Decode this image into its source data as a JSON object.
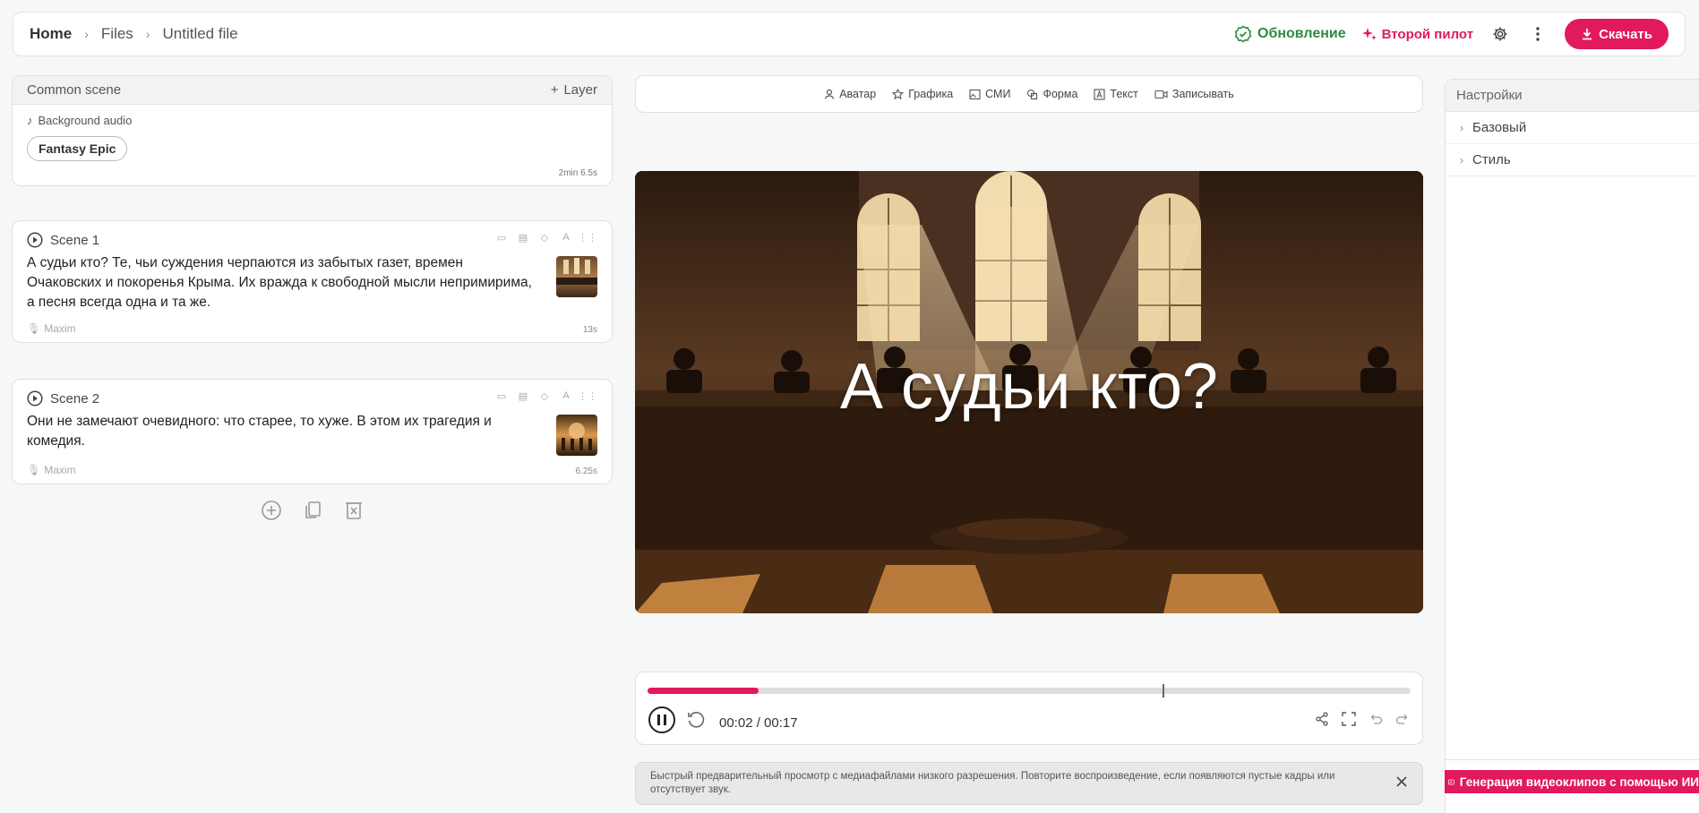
{
  "breadcrumb": {
    "home": "Home",
    "files": "Files",
    "file": "Untitled file"
  },
  "header": {
    "update_label": "Обновление",
    "copilot_label": "Второй пилот",
    "download_label": "Скачать"
  },
  "common_scene": {
    "title": "Common scene",
    "layer_label": "Layer",
    "bg_audio_label": "Background audio",
    "audio_chip": "Fantasy Epic",
    "duration": "2min 6.5s"
  },
  "scenes": [
    {
      "title": "Scene 1",
      "text": "А судьи кто? Те, чьи суждения черпаются из забытых газет, времен Очаковских и покоренья Крыма. Их вражда к свободной мысли непримирима, а песня всегда одна и та же.",
      "voice": "Maxim",
      "duration": "13s"
    },
    {
      "title": "Scene 2",
      "text": "Они не замечают очевидного: что старее, то хуже. В этом их трагедия и комедия.",
      "voice": "Maxim",
      "duration": "6.25s"
    }
  ],
  "toolbar": {
    "avatar": "Аватар",
    "graphics": "Графика",
    "media": "СМИ",
    "shape": "Форма",
    "text": "Текст",
    "record": "Записывать"
  },
  "preview": {
    "caption": "А судьи кто?"
  },
  "player": {
    "timecode": "00:02 / 00:17",
    "progress": 0.145,
    "marker": 0.675
  },
  "notice": {
    "text": "Быстрый предварительный просмотр с медиафайлами низкого разрешения. Повторите воспроизведение, если появляются пустые кадры или отсутствует звук."
  },
  "settings": {
    "title": "Настройки",
    "sections": [
      "Базовый",
      "Стиль"
    ],
    "gen_label": "Генерация видеоклипов с помощью ИИ"
  },
  "colors": {
    "accent": "#e2195c",
    "update_green": "#2e8b46"
  }
}
